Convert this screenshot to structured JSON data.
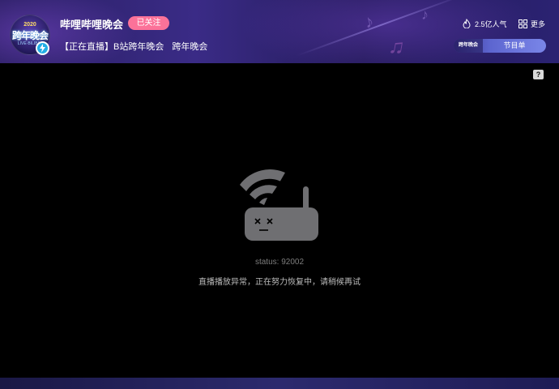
{
  "header": {
    "channel_name": "哔哩哔哩晚会",
    "follow_label": "已关注",
    "title_main": "【正在直播】B站跨年晚会",
    "title_sub": "跨年晚会",
    "popularity": "2.5亿人气",
    "more_label": "更多",
    "schedule": {
      "logo_text": "跨年晚会",
      "label": "节目单"
    },
    "avatar": {
      "top_text": "2020",
      "main_text": "跨年晚会",
      "bottom_text": "LIVE·BILIBILI"
    }
  },
  "player": {
    "help_label": "?",
    "status": "status: 92002",
    "error_message": "直播播放异常，正在努力恢复中，请稍候再试"
  },
  "colors": {
    "follow": "#fb7299",
    "live_badge": "#23aee5",
    "icon_grey": "#6f6f72"
  },
  "icons": {
    "live": "lightning-icon",
    "popularity": "flame-icon",
    "more": "grid-icon",
    "error": "broken-router-icon"
  }
}
